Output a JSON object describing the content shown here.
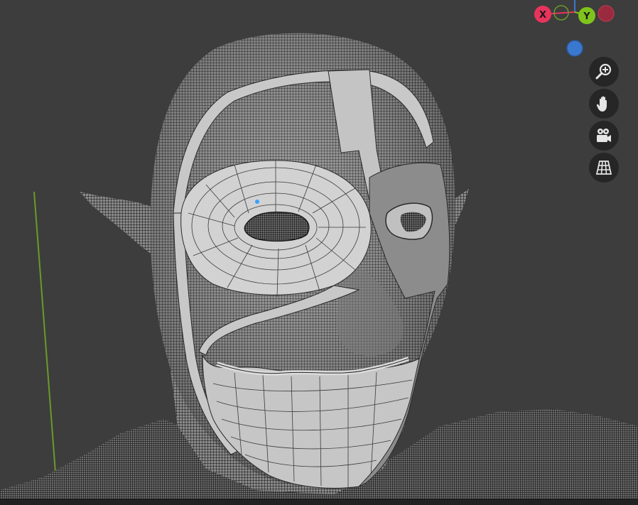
{
  "viewport": {
    "background": "#3d3d3d",
    "wire_color": "#0a0a0a",
    "retopo_face_color": "#c8c8c8",
    "retopo_edge_color": "#2a2a2a",
    "grid_y_axis_color": "#6a9a2a"
  },
  "gizmo": {
    "x_label": "X",
    "y_label": "Y",
    "x_color": "#e8345c",
    "y_color": "#7fc41c",
    "z_color": "#3a78d0",
    "neg_x_color": "#9a2a3e",
    "neg_y_color": "#4d7a1c"
  },
  "nav_buttons": [
    {
      "name": "zoom-view-button",
      "icon": "zoom-icon"
    },
    {
      "name": "pan-view-button",
      "icon": "hand-icon"
    },
    {
      "name": "camera-view-button",
      "icon": "camera-icon"
    },
    {
      "name": "perspective-toggle-button",
      "icon": "grid-icon"
    }
  ]
}
